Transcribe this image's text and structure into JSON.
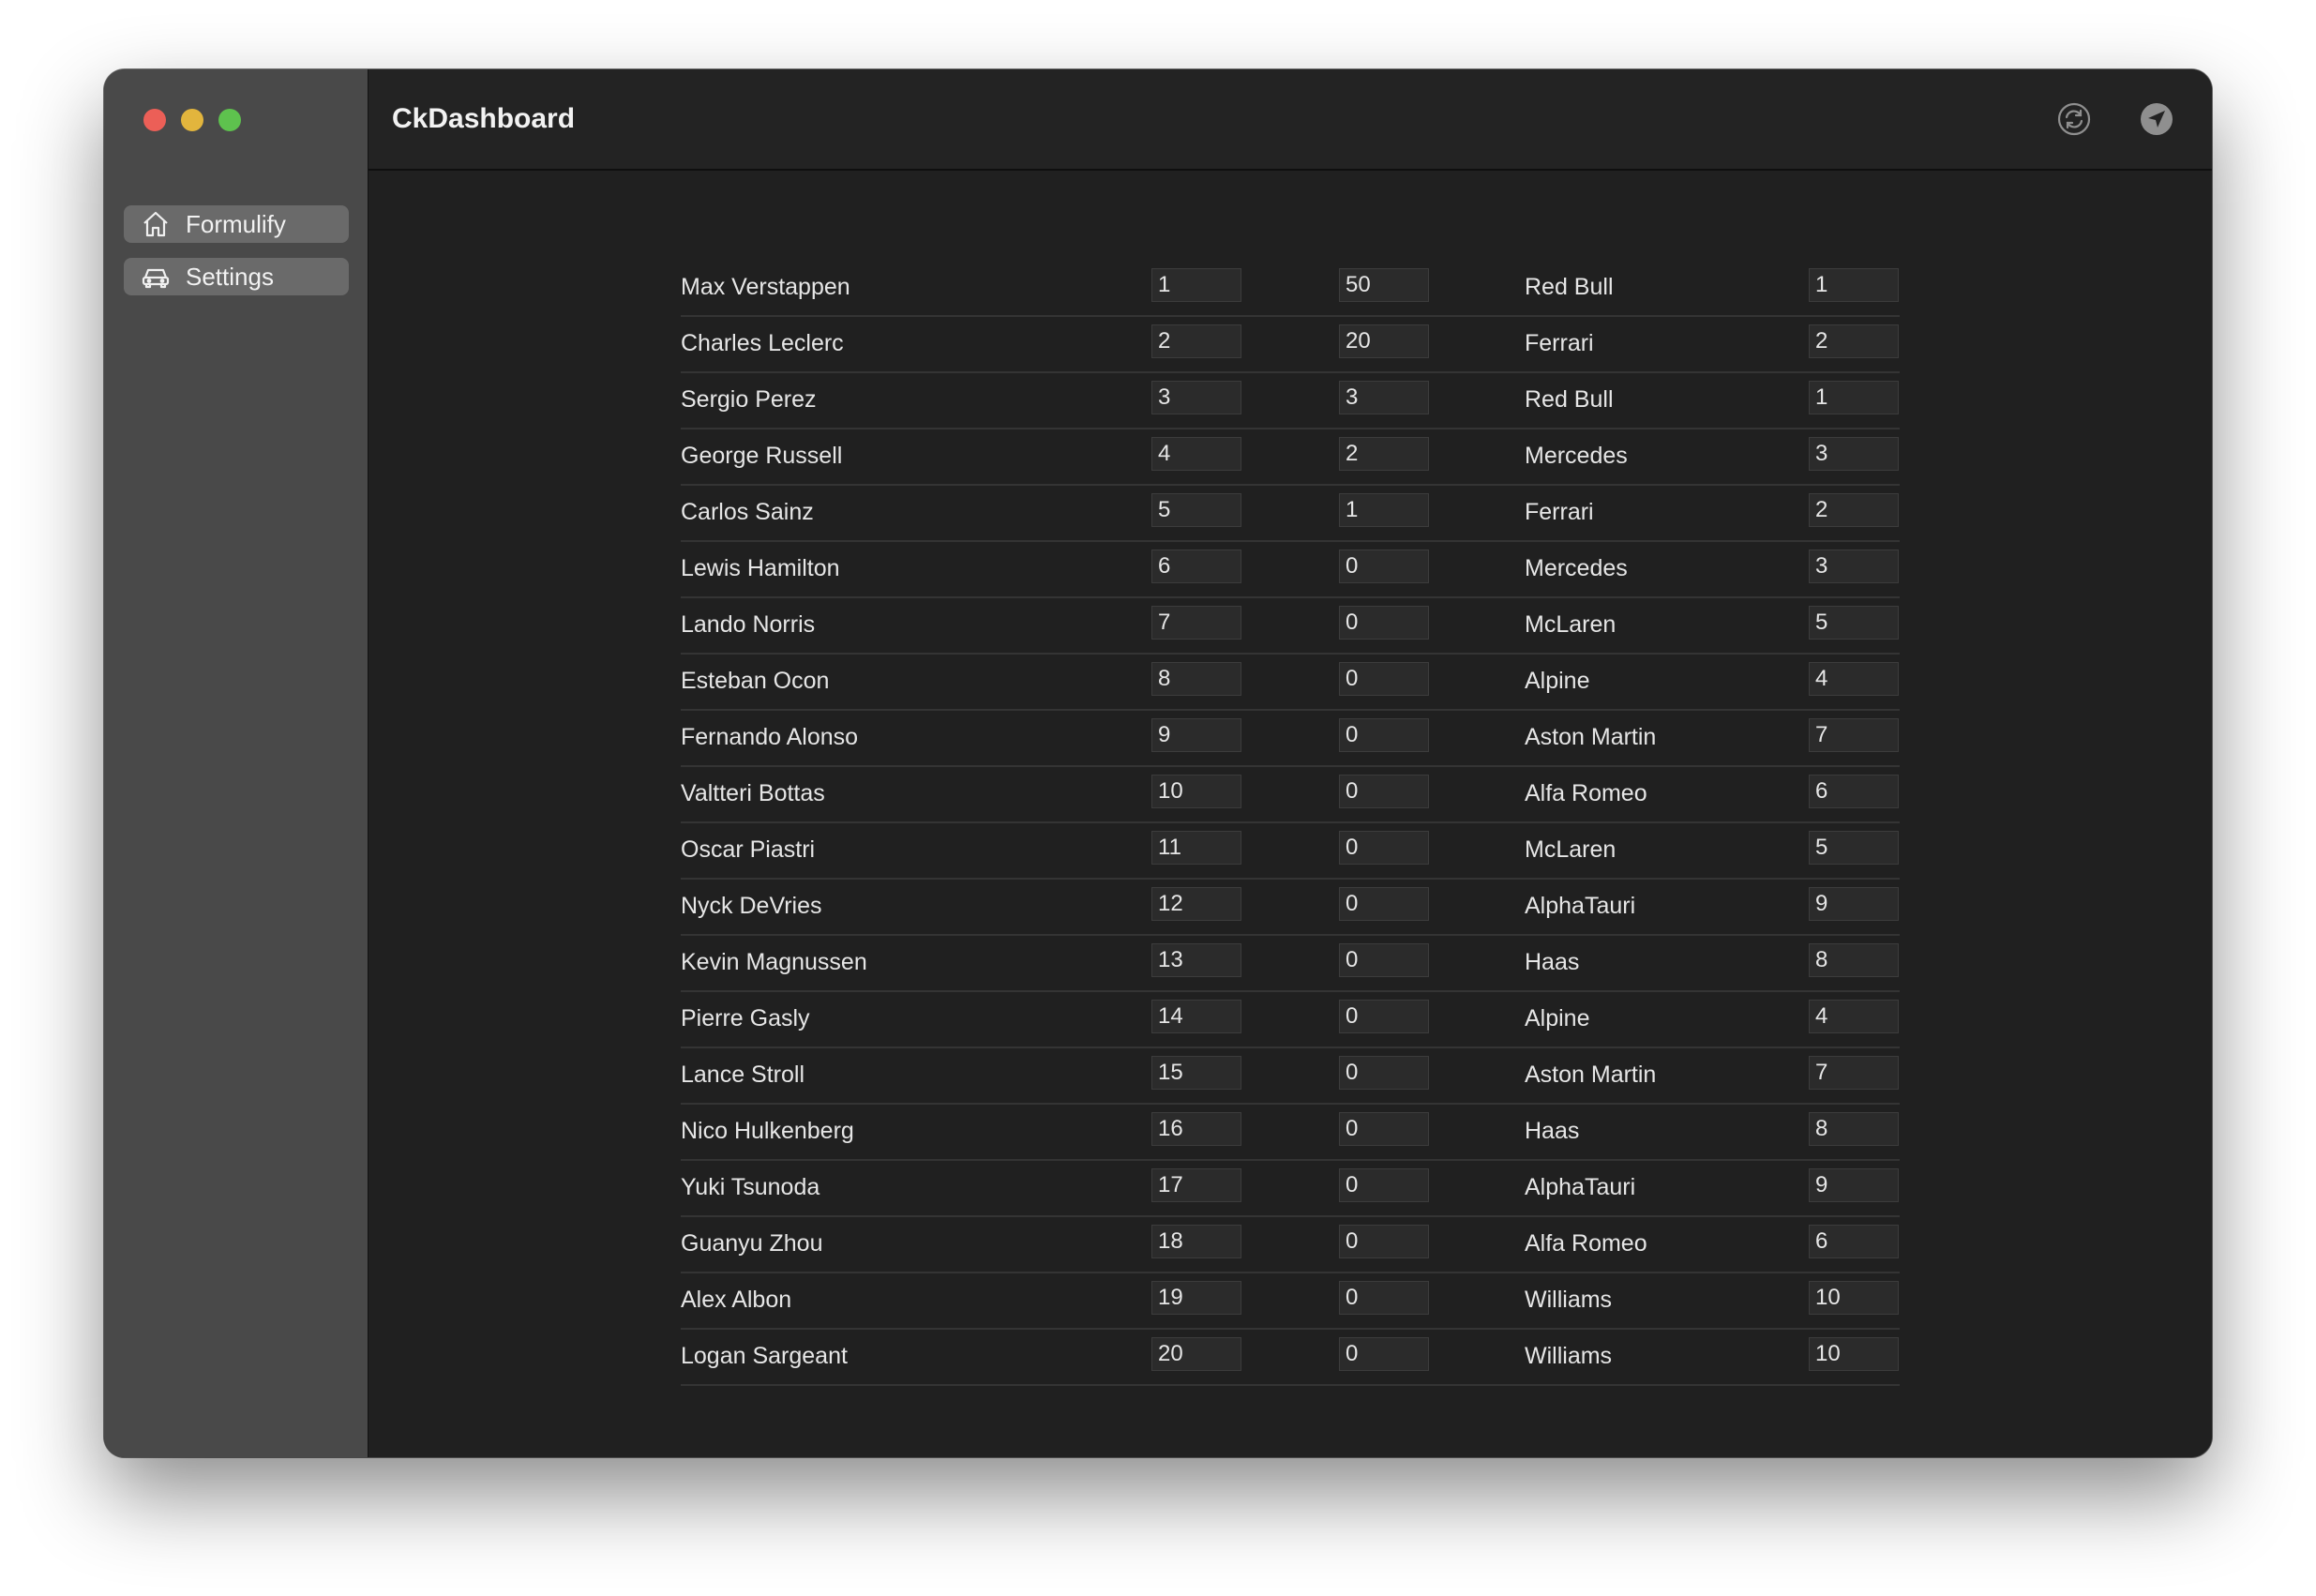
{
  "window": {
    "title": "CkDashboard"
  },
  "sidebar": {
    "items": [
      {
        "label": "Formulify",
        "icon": "house-icon"
      },
      {
        "label": "Settings",
        "icon": "car-icon"
      }
    ]
  },
  "toolbar": {
    "icons": [
      "refresh-icon",
      "send-icon"
    ]
  },
  "drivers": [
    {
      "name": "Max Verstappen",
      "position": "1",
      "points": "50",
      "team": "Red Bull",
      "team_rank": "1"
    },
    {
      "name": "Charles Leclerc",
      "position": "2",
      "points": "20",
      "team": "Ferrari",
      "team_rank": "2"
    },
    {
      "name": "Sergio Perez",
      "position": "3",
      "points": "3",
      "team": "Red Bull",
      "team_rank": "1"
    },
    {
      "name": "George Russell",
      "position": "4",
      "points": "2",
      "team": "Mercedes",
      "team_rank": "3"
    },
    {
      "name": "Carlos Sainz",
      "position": "5",
      "points": "1",
      "team": "Ferrari",
      "team_rank": "2"
    },
    {
      "name": "Lewis Hamilton",
      "position": "6",
      "points": "0",
      "team": "Mercedes",
      "team_rank": "3"
    },
    {
      "name": "Lando Norris",
      "position": "7",
      "points": "0",
      "team": "McLaren",
      "team_rank": "5"
    },
    {
      "name": "Esteban Ocon",
      "position": "8",
      "points": "0",
      "team": "Alpine",
      "team_rank": "4"
    },
    {
      "name": "Fernando Alonso",
      "position": "9",
      "points": "0",
      "team": "Aston Martin",
      "team_rank": "7"
    },
    {
      "name": "Valtteri Bottas",
      "position": "10",
      "points": "0",
      "team": "Alfa Romeo",
      "team_rank": "6"
    },
    {
      "name": "Oscar Piastri",
      "position": "11",
      "points": "0",
      "team": "McLaren",
      "team_rank": "5"
    },
    {
      "name": "Nyck DeVries",
      "position": "12",
      "points": "0",
      "team": "AlphaTauri",
      "team_rank": "9"
    },
    {
      "name": "Kevin Magnussen",
      "position": "13",
      "points": "0",
      "team": "Haas",
      "team_rank": "8"
    },
    {
      "name": "Pierre Gasly",
      "position": "14",
      "points": "0",
      "team": "Alpine",
      "team_rank": "4"
    },
    {
      "name": "Lance Stroll",
      "position": "15",
      "points": "0",
      "team": "Aston Martin",
      "team_rank": "7"
    },
    {
      "name": "Nico Hulkenberg",
      "position": "16",
      "points": "0",
      "team": "Haas",
      "team_rank": "8"
    },
    {
      "name": "Yuki Tsunoda",
      "position": "17",
      "points": "0",
      "team": "AlphaTauri",
      "team_rank": "9"
    },
    {
      "name": "Guanyu Zhou",
      "position": "18",
      "points": "0",
      "team": "Alfa Romeo",
      "team_rank": "6"
    },
    {
      "name": "Alex Albon",
      "position": "19",
      "points": "0",
      "team": "Williams",
      "team_rank": "10"
    },
    {
      "name": "Logan Sargeant",
      "position": "20",
      "points": "0",
      "team": "Williams",
      "team_rank": "10"
    }
  ]
}
